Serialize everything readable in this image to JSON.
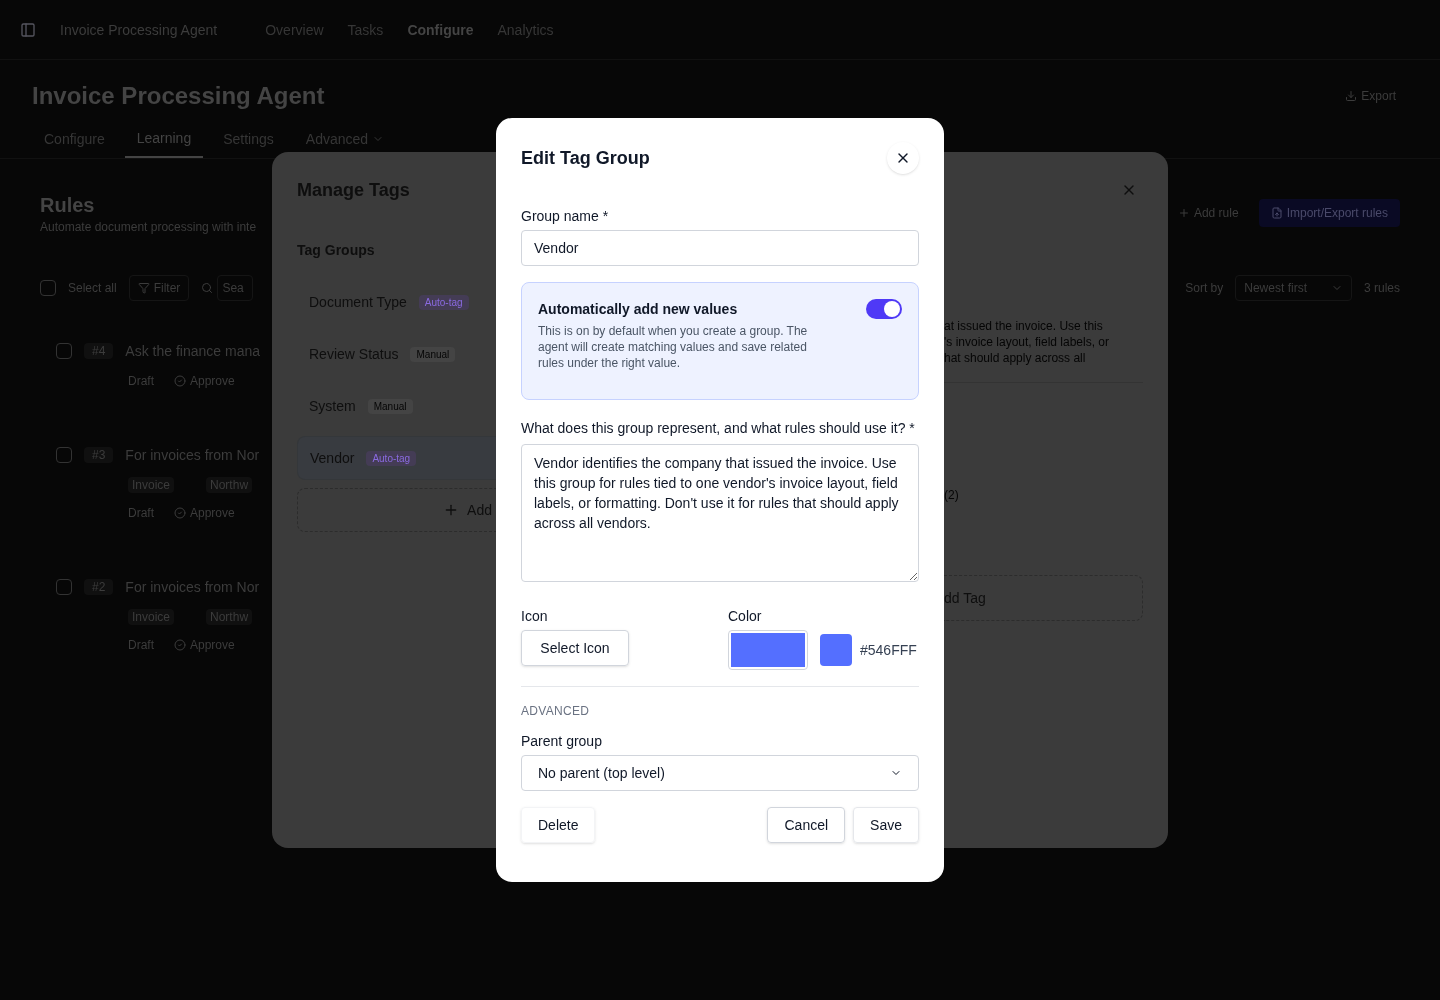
{
  "topbar": {
    "app_title": "Invoice Processing Agent",
    "nav": [
      {
        "label": "Overview",
        "selected": false
      },
      {
        "label": "Tasks",
        "selected": false
      },
      {
        "label": "Configure",
        "selected": true
      },
      {
        "label": "Analytics",
        "selected": false
      }
    ]
  },
  "page": {
    "title": "Invoice Processing Agent",
    "export": "Export",
    "tabs": [
      {
        "label": "Configure",
        "selected": false
      },
      {
        "label": "Learning",
        "selected": true
      },
      {
        "label": "Settings",
        "selected": false
      },
      {
        "label": "Advanced",
        "selected": false
      }
    ],
    "rules": {
      "heading": "Rules",
      "subtitle": "Automate document processing with inte",
      "add_rule": "Add rule",
      "import_export": "Import/Export rules",
      "select_all": "Select all",
      "select_all_checked": false,
      "filter": "Filter",
      "search_placeholder": "Sea",
      "sort_label": "Sort by",
      "sort_value": "Newest first",
      "count": "3 rules",
      "items": [
        {
          "checked": false,
          "number": "#4",
          "title": "Ask the finance mana",
          "status": "Draft",
          "action": "Approve"
        },
        {
          "checked": false,
          "number": "#3",
          "title": "For invoices from Nor",
          "tags": [
            "Invoice",
            "Northw"
          ],
          "status": "Draft",
          "action": "Approve"
        },
        {
          "checked": false,
          "number": "#2",
          "title": "For invoices from Nor",
          "tags": [
            "Invoice",
            "Northw"
          ],
          "status": "Draft",
          "action": "Approve"
        }
      ]
    }
  },
  "manage_tags": {
    "title": "Manage Tags",
    "section": "Tag Groups",
    "groups": [
      {
        "name": "Document Type",
        "mode": "Auto-tag",
        "kind": "auto",
        "selected": false
      },
      {
        "name": "Review Status",
        "mode": "Manual",
        "kind": "manual",
        "selected": false
      },
      {
        "name": "System",
        "mode": "Manual",
        "kind": "manual",
        "selected": false
      },
      {
        "name": "Vendor",
        "mode": "Auto-tag",
        "kind": "auto",
        "selected": true
      }
    ],
    "add_group": "Add",
    "description_lines": [
      "at issued the invoice. Use this",
      "'s invoice layout, field labels, or",
      "hat should apply across all"
    ],
    "tag_count": "(2)",
    "add_tag": "dd Tag"
  },
  "edit_dialog": {
    "title": "Edit Tag Group",
    "name_label": "Group name *",
    "name_value": "Vendor",
    "auto_add": {
      "title": "Automatically add new values",
      "text": "This is on by default when you create a group. The agent will create matching values and save related rules under the right value.",
      "on": true
    },
    "description_label": "What does this group represent, and what rules should use it? *",
    "description_value": "Vendor identifies the company that issued the invoice. Use this group for rules tied to one vendor's invoice layout, field labels, or formatting. Don't use it for rules that should apply across all vendors.",
    "icon_label": "Icon",
    "icon_button": "Select Icon",
    "color_label": "Color",
    "color": "#546fff",
    "color_text": "#546FFF",
    "advanced_heading": "ADVANCED",
    "parent_label": "Parent group",
    "parent_value": "No parent (top level)",
    "buttons": {
      "delete": "Delete",
      "cancel": "Cancel",
      "save": "Save"
    }
  }
}
